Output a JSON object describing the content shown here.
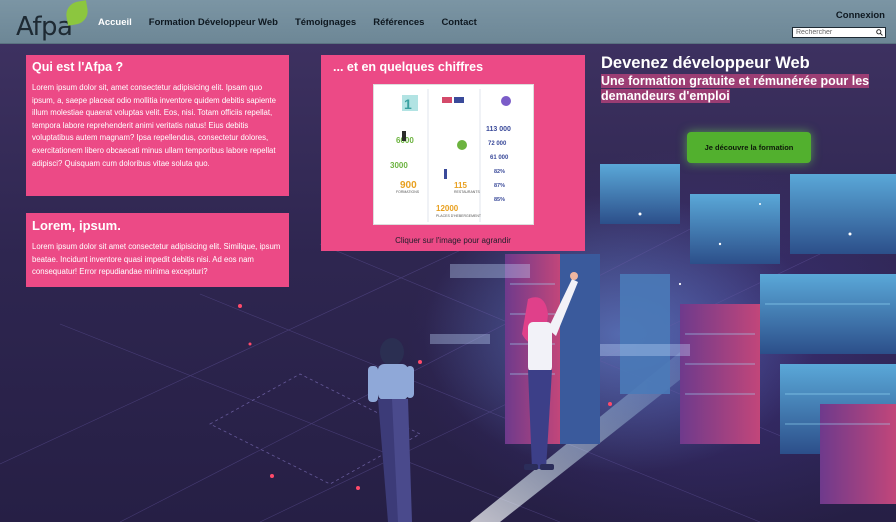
{
  "header": {
    "logo_text": "Afpa",
    "nav": [
      {
        "label": "Accueil",
        "active": true
      },
      {
        "label": "Formation Développeur Web",
        "active": false
      },
      {
        "label": "Témoignages",
        "active": false
      },
      {
        "label": "Références",
        "active": false
      },
      {
        "label": "Contact",
        "active": false
      }
    ],
    "connexion_label": "Connexion",
    "search_placeholder": "Rechercher"
  },
  "cards": {
    "qui": {
      "title": "Qui est l'Afpa ?",
      "text": "Lorem ipsum dolor sit, amet consectetur adipisicing elit. Ipsam quo ipsum, a, saepe placeat odio mollitia inventore quidem debitis sapiente illum molestiae quaerat voluptas velit. Eos, nisi. Totam officiis repellat, tempora labore reprehenderit animi veritatis natus! Eius debitis voluptatibus autem magnam? Ipsa repellendus, consectetur dolores, exercitationem libero obcaecati minus ullam temporibus labore repellat adipisci? Quisquam cum doloribus vitae soluta quo."
    },
    "lorem": {
      "title": "Lorem, ipsum.",
      "text": "Lorem ipsum dolor sit amet consectetur adipisicing elit. Similique, ipsum beatae. Incidunt inventore quasi impedit debitis nisi. Ad eos nam consequatur! Error repudiandae minima excepturi?"
    },
    "chiffres": {
      "title": "... et en quelques chiffres",
      "caption": "Cliquer sur l'image pour agrandir",
      "infographic": {
        "numbers": [
          "1",
          "6000",
          "3000",
          "900",
          "115",
          "12000",
          "113 000",
          "72 000",
          "61 000",
          "82%",
          "87%",
          "85%"
        ],
        "labels": [
          "FORMATIONS",
          "PLACES D'HEBERGEMENT",
          "RESTAURANTS"
        ]
      }
    }
  },
  "hero": {
    "title": "Devenez développeur Web",
    "subtitle": "Une formation gratuite et rémunérée pour les demandeurs d'emploi",
    "cta_label": "Je découvre la formation"
  },
  "colors": {
    "header_bg": "#7b95a4",
    "card_pink": "#ec4a86",
    "cta_green": "#52b02e",
    "logo_leaf": "#8cc63f"
  }
}
